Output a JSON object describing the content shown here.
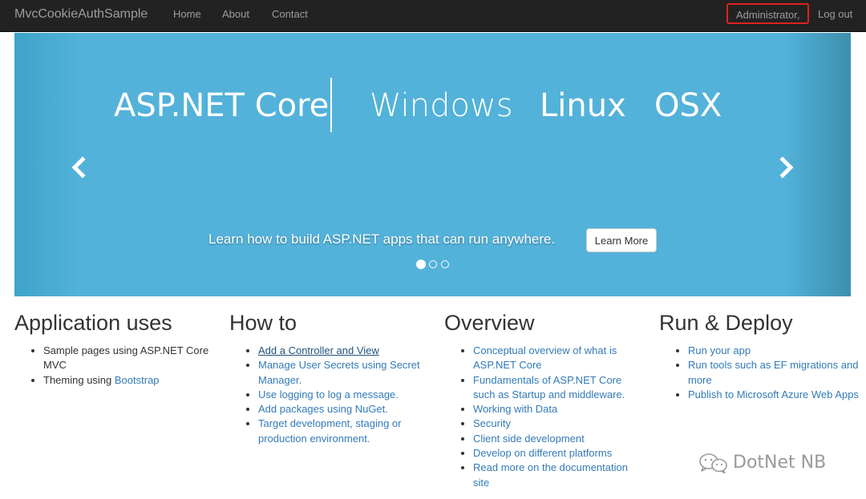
{
  "navbar": {
    "brand": "MvcCookieAuthSample",
    "links": [
      "Home",
      "About",
      "Contact"
    ],
    "user": "Administrator,",
    "logout": "Log out"
  },
  "carousel": {
    "banner": {
      "product": "ASP.NET Core",
      "platforms": [
        "Windows",
        "Linux",
        "OSX"
      ]
    },
    "caption": "Learn how to build ASP.NET apps that can run anywhere.",
    "button": "Learn More",
    "prev_icon": "chevron-left-icon",
    "next_icon": "chevron-right-icon",
    "slide_count": 3,
    "active_slide": 0
  },
  "columns": [
    {
      "title": "Application uses",
      "items": [
        {
          "text": "Sample pages using ASP.NET Core MVC"
        },
        {
          "text": "Theming using ",
          "link": "Bootstrap"
        }
      ]
    },
    {
      "title": "How to",
      "items": [
        {
          "link": "Add a Controller and View"
        },
        {
          "link": "Manage User Secrets using Secret Manager."
        },
        {
          "link": "Use logging to log a message."
        },
        {
          "link": "Add packages using NuGet."
        },
        {
          "link": "Target development, staging or production environment."
        }
      ]
    },
    {
      "title": "Overview",
      "items": [
        {
          "link": "Conceptual overview of what is ASP.NET Core"
        },
        {
          "link": "Fundamentals of ASP.NET Core such as Startup and middleware."
        },
        {
          "link": "Working with Data"
        },
        {
          "link": "Security"
        },
        {
          "link": "Client side development"
        },
        {
          "link": "Develop on different platforms"
        },
        {
          "link": "Read more on the documentation site"
        }
      ]
    },
    {
      "title": "Run & Deploy",
      "items": [
        {
          "link": "Run your app"
        },
        {
          "link": "Run tools such as EF migrations and more"
        },
        {
          "link": "Publish to Microsoft Azure Web Apps"
        }
      ]
    }
  ],
  "watermark": {
    "text": "DotNet NB",
    "icon": "wechat-icon"
  },
  "colors": {
    "navbar": "#222222",
    "nav_text": "#9d9d9d",
    "carousel": "#53b2d9",
    "link": "#337ab7",
    "highlight": "#e02020"
  }
}
